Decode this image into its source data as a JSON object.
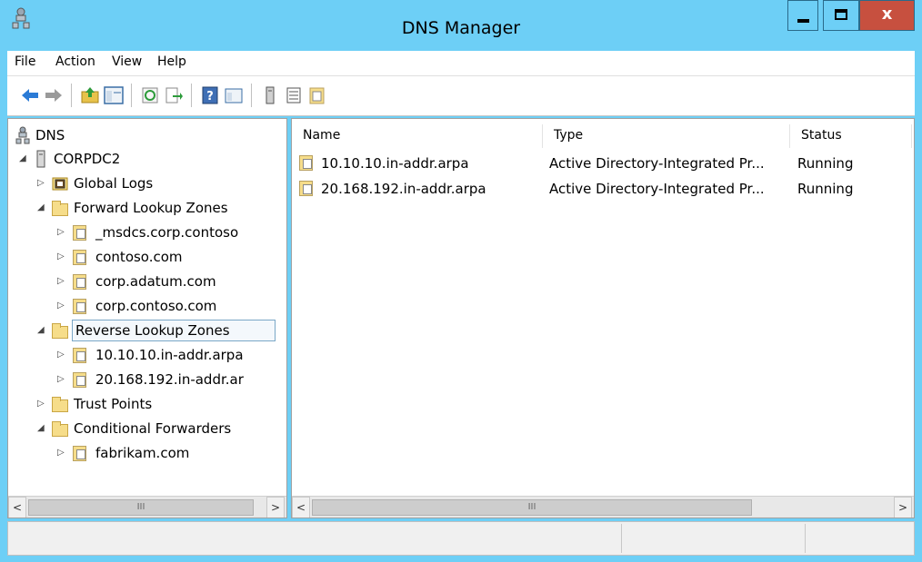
{
  "window": {
    "title": "DNS Manager"
  },
  "menu": [
    "File",
    "Action",
    "View",
    "Help"
  ],
  "toolbar": {
    "icons": [
      "back-icon",
      "forward-icon",
      "up-folder-icon",
      "show-hide-tree-icon",
      "refresh-icon",
      "export-list-icon",
      "help-icon",
      "properties-icon",
      "server-icon",
      "list-icon",
      "zone-icon"
    ]
  },
  "tree": {
    "root": "DNS",
    "server": "CORPDC2",
    "items": [
      {
        "label": "Global Logs"
      },
      {
        "label": "Forward Lookup Zones"
      },
      {
        "label": "_msdcs.corp.contoso"
      },
      {
        "label": "contoso.com"
      },
      {
        "label": "corp.adatum.com"
      },
      {
        "label": "corp.contoso.com"
      },
      {
        "label": "Reverse Lookup Zones"
      },
      {
        "label": "10.10.10.in-addr.arpa"
      },
      {
        "label": "20.168.192.in-addr.ar"
      },
      {
        "label": "Trust Points"
      },
      {
        "label": "Conditional Forwarders"
      },
      {
        "label": "fabrikam.com"
      }
    ]
  },
  "list": {
    "columns": [
      "Name",
      "Type",
      "Status"
    ],
    "rows": [
      {
        "name": "10.10.10.in-addr.arpa",
        "type": "Active Directory-Integrated Pr...",
        "status": "Running"
      },
      {
        "name": "20.168.192.in-addr.arpa",
        "type": "Active Directory-Integrated Pr...",
        "status": "Running"
      }
    ]
  },
  "scroll": {
    "thumb_glyph": "III",
    "left_arrow": "<",
    "right_arrow": ">"
  },
  "controls": {
    "close": "x"
  }
}
